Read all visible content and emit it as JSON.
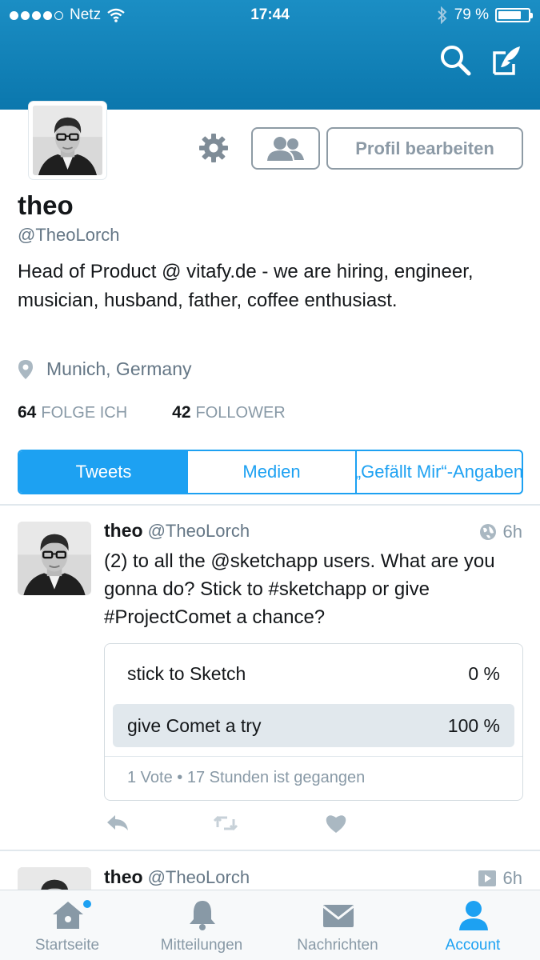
{
  "status_bar": {
    "carrier": "Netz",
    "time": "17:44",
    "battery": "79 %",
    "battery_level": 0.79
  },
  "header": {
    "icons": [
      "search-icon",
      "compose-icon"
    ]
  },
  "profile": {
    "name": "theo",
    "handle": "@TheoLorch",
    "bio": "Head of Product @ vitafy.de - we are hiring, engineer, musician, husband, father, coffee enthusiast.",
    "location": "Munich, Germany",
    "edit_button": "Profil bearbeiten",
    "following_count": "64",
    "following_label": "FOLGE ICH",
    "followers_count": "42",
    "followers_label": "FOLLOWER"
  },
  "tabs": [
    {
      "label": "Tweets",
      "active": true
    },
    {
      "label": "Medien",
      "active": false
    },
    {
      "label": "„Gefällt Mir“-Angaben",
      "active": false
    }
  ],
  "tweets": [
    {
      "name": "theo",
      "handle": "@TheoLorch",
      "time": "6h",
      "text": "(2) to all the @sketchapp users. What are you gonna do? Stick to #sketchapp or give #ProjectComet a chance?",
      "poll": {
        "options": [
          {
            "label": "stick to Sketch",
            "percent": "0 %"
          },
          {
            "label": "give Comet a try",
            "percent": "100 %"
          }
        ],
        "meta": "1 Vote • 17 Stunden ist gegangen"
      }
    },
    {
      "name": "theo",
      "handle": "@TheoLorch",
      "time": "6h"
    }
  ],
  "tabbar": [
    {
      "label": "Startseite",
      "icon": "home-icon",
      "active": false
    },
    {
      "label": "Mitteilungen",
      "icon": "bell-icon",
      "active": false
    },
    {
      "label": "Nachrichten",
      "icon": "envelope-icon",
      "active": false
    },
    {
      "label": "Account",
      "icon": "person-icon",
      "active": true
    }
  ],
  "colors": {
    "header": "#0b77ad",
    "accent": "#1da1f2",
    "secondary_text": "#657786"
  }
}
